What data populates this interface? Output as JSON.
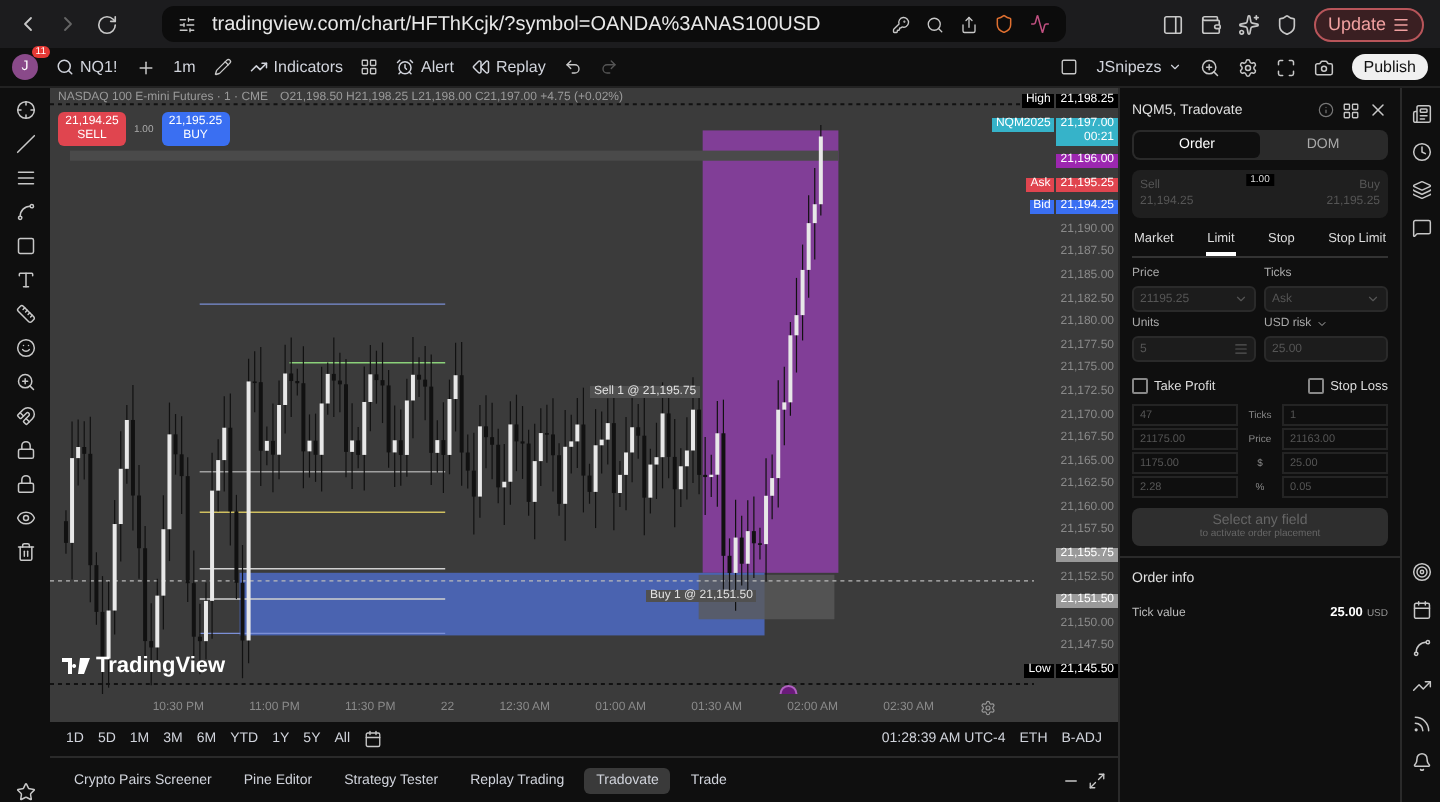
{
  "browser": {
    "url": "tradingview.com/chart/HFThKcjk/?symbol=OANDA%3ANAS100USD",
    "update_button": "Update"
  },
  "toolbar": {
    "avatar": "J",
    "badge": "11",
    "symbol": "NQ1!",
    "interval": "1m",
    "indicators": "Indicators",
    "alert": "Alert",
    "replay": "Replay",
    "layout_name": "JSnipezs",
    "publish": "Publish"
  },
  "chart": {
    "legend": "NASDAQ 100 E-mini Futures · 1 · CME",
    "ohlc": "O21,198.50 H21,198.25 L21,198.00 C21,197.00 +4.75 (+0.02%)",
    "sell": {
      "price": "21,194.25",
      "label": "SELL"
    },
    "spread": "1.00",
    "buy": {
      "price": "21,195.25",
      "label": "BUY"
    },
    "sell_order": "Sell 1 @ 21,195.75",
    "buy_order": "Buy 1 @ 21,151.50",
    "logo": "TradingView"
  },
  "price_axis": [
    {
      "kind": "high",
      "tag": "High",
      "value": "21,198.25"
    },
    {
      "kind": "symbol",
      "tag": "NQM2025",
      "value": "21,197.00",
      "sub": "00:21"
    },
    {
      "kind": "alert",
      "value": "21,196.00"
    },
    {
      "kind": "ask",
      "tag": "Ask",
      "value": "21,195.25"
    },
    {
      "kind": "bid",
      "tag": "Bid",
      "value": "21,194.25"
    },
    {
      "kind": "plain",
      "value": "21,190.00"
    },
    {
      "kind": "plain",
      "value": "21,187.50"
    },
    {
      "kind": "plain",
      "value": "21,185.00"
    },
    {
      "kind": "plain",
      "value": "21,182.50"
    },
    {
      "kind": "plain",
      "value": "21,180.00"
    },
    {
      "kind": "plain",
      "value": "21,177.50"
    },
    {
      "kind": "plain",
      "value": "21,175.00"
    },
    {
      "kind": "plain",
      "value": "21,172.50"
    },
    {
      "kind": "plain",
      "value": "21,170.00"
    },
    {
      "kind": "plain",
      "value": "21,167.50"
    },
    {
      "kind": "plain",
      "value": "21,165.00"
    },
    {
      "kind": "plain",
      "value": "21,162.50"
    },
    {
      "kind": "plain",
      "value": "21,160.00"
    },
    {
      "kind": "plain",
      "value": "21,157.50"
    },
    {
      "kind": "last",
      "value": "21,155.75"
    },
    {
      "kind": "plain",
      "value": "21,152.50"
    },
    {
      "kind": "last",
      "value": "21,151.50"
    },
    {
      "kind": "plain",
      "value": "21,150.00"
    },
    {
      "kind": "plain",
      "value": "21,147.50"
    },
    {
      "kind": "low",
      "tag": "Low",
      "value": "21,145.50"
    }
  ],
  "time_axis": [
    "10:30 PM",
    "11:00 PM",
    "11:30 PM",
    "22",
    "12:30 AM",
    "01:00 AM",
    "01:30 AM",
    "02:00 AM",
    "02:30 AM"
  ],
  "ranges": [
    "1D",
    "5D",
    "1M",
    "3M",
    "6M",
    "YTD",
    "1Y",
    "5Y",
    "All"
  ],
  "clock": "01:28:39 AM UTC-4",
  "session": "ETH",
  "adjust": "B-ADJ",
  "bottom_tabs": [
    {
      "label": "Crypto Pairs Screener",
      "selected": false
    },
    {
      "label": "Pine Editor",
      "selected": false
    },
    {
      "label": "Strategy Tester",
      "selected": false
    },
    {
      "label": "Replay Trading",
      "selected": false
    },
    {
      "label": "Tradovate",
      "selected": true
    },
    {
      "label": "Trade",
      "selected": false
    }
  ],
  "order_panel": {
    "title": "NQM5, Tradovate",
    "tabs": [
      {
        "label": "Order",
        "selected": true
      },
      {
        "label": "DOM",
        "selected": false
      }
    ],
    "sell": {
      "label": "Sell",
      "price": "21,194.25"
    },
    "quantity": "1.00",
    "buy": {
      "label": "Buy",
      "price": "21,195.25"
    },
    "order_types": [
      {
        "label": "Market",
        "selected": false
      },
      {
        "label": "Limit",
        "selected": true
      },
      {
        "label": "Stop",
        "selected": false
      },
      {
        "label": "Stop Limit",
        "selected": false
      }
    ],
    "price_label": "Price",
    "price_value": "21195.25",
    "ticks_label": "Ticks",
    "ticks_value": "Ask",
    "units_label": "Units",
    "risk_label": "USD risk",
    "units_value": "5",
    "risk_value": "25.00",
    "take_profit": {
      "label": "Take Profit",
      "checked": false,
      "values": [
        "47",
        "21175.00",
        "1175.00",
        "2.28"
      ]
    },
    "stop_loss": {
      "label": "Stop Loss",
      "checked": false,
      "values": [
        "1",
        "21163.00",
        "25.00",
        "0.05"
      ]
    },
    "row_labels": [
      "Ticks",
      "Price",
      "$",
      "%"
    ],
    "submit": {
      "label": "Select any field",
      "hint": "to activate order placement",
      "disabled": true
    },
    "info_title": "Order info",
    "tick_label": "Tick value",
    "tick_value": "25.00",
    "tick_unit": "USD"
  }
}
